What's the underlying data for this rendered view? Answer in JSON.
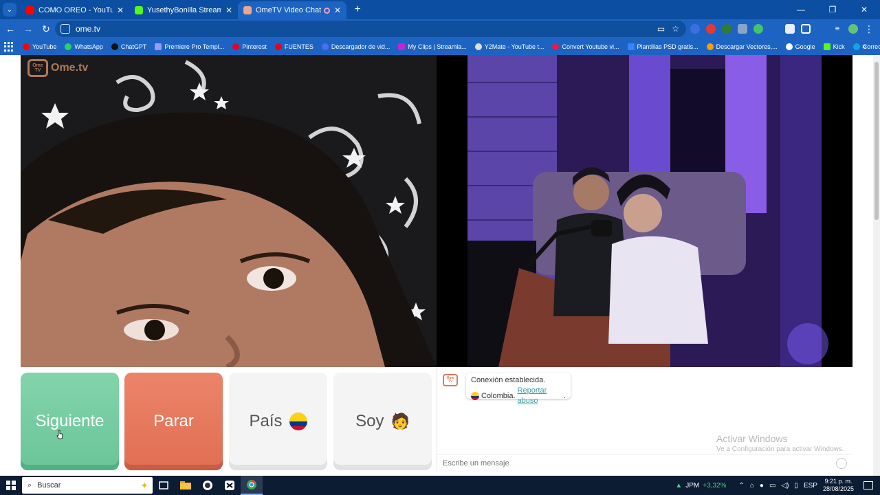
{
  "tabs": [
    {
      "title": "COMO OREO - YouTube",
      "favicon_color": "#ff0000",
      "active": false
    },
    {
      "title": "YusethyBonilla Stream - Watch",
      "favicon_color": "#53fc18",
      "active": false
    },
    {
      "title": "OmeTV Video Chat — Ome",
      "favicon_color": "#f1a58a",
      "active": true
    }
  ],
  "address": {
    "url": "ome.tv"
  },
  "bookmarks": [
    {
      "label": "YouTube",
      "color": "#ff0000"
    },
    {
      "label": "WhatsApp",
      "color": "#25d366"
    },
    {
      "label": "ChatGPT",
      "color": "#111111"
    },
    {
      "label": "Premiere Pro Templ...",
      "color": "#9999ff"
    },
    {
      "label": "Pinterest",
      "color": "#e60023"
    },
    {
      "label": "FUENTES",
      "color": "#e60023"
    },
    {
      "label": "Descargador de vid...",
      "color": "#4a6cf7"
    },
    {
      "label": "My Clips | Streamla...",
      "color": "#c026d3"
    },
    {
      "label": "Y2Mate - YouTube t...",
      "color": "#dddddd"
    },
    {
      "label": "Convert Youtube vi...",
      "color": "#e11d48"
    },
    {
      "label": "Plantillas PSD gratis...",
      "color": "#3b82f6"
    },
    {
      "label": "Descargar Vectores,...",
      "color": "#f59e0b"
    },
    {
      "label": "Google",
      "color": "#ffffff"
    },
    {
      "label": "Kick",
      "color": "#53fc18"
    },
    {
      "label": "Corrección de Texto...",
      "color": "#0ea5e9"
    }
  ],
  "logo": {
    "tv": "Ome TV",
    "brand": "Ome.tv"
  },
  "controls": {
    "next": "Siguiente",
    "stop": "Parar",
    "country": "País",
    "gender": "Soy",
    "gender_emoji": "🧑"
  },
  "chat": {
    "logo": "Ome TV",
    "status": "Conexión establecida.",
    "country": "Colombia.",
    "report": "Reportar abuso",
    "report_suffix": ".",
    "placeholder": "Escribe un mensaje",
    "watermark_title": "Activar Windows",
    "watermark_sub": "Ve a Configuración para activar Windows."
  },
  "taskbar": {
    "search_label": "Buscar",
    "stock_symbol": "JPM",
    "stock_change": "+3,32%",
    "language": "ESP",
    "time": "9:21 p. m.",
    "date": "28/08/2025"
  }
}
